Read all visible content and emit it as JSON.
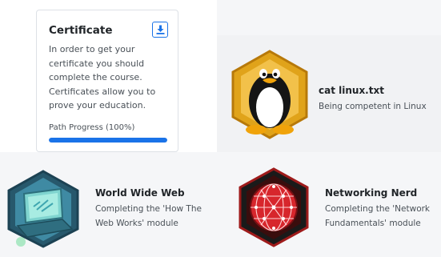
{
  "certificate": {
    "title": "Certificate",
    "download_icon": "download-icon",
    "description": "In order to get your certificate you should complete the course. Certificates allow you to prove your education.",
    "progress_label": "Path Progress (100%)",
    "progress_value": 1.0,
    "accent_color": "#1a73e8"
  },
  "badges": [
    {
      "title": "cat linux.txt",
      "description": "Being competent in Linux",
      "icon": "linux-penguin-badge-icon"
    },
    {
      "title": "World Wide Web",
      "description": "Completing the 'How The Web Works' module",
      "icon": "laptop-badge-icon"
    },
    {
      "title": "Networking Nerd",
      "description": "Completing the 'Network Fundamentals' module",
      "icon": "network-globe-badge-icon"
    }
  ]
}
